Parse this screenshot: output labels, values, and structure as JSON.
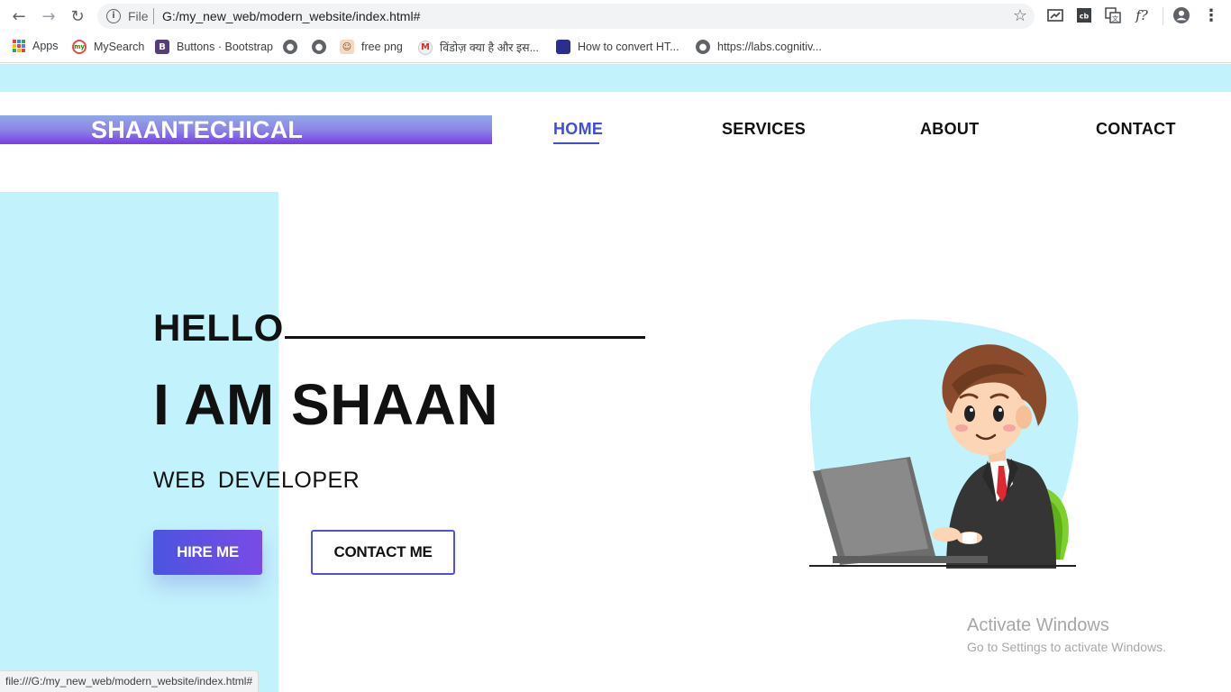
{
  "browser": {
    "file_label": "File",
    "url": "G:/my_new_web/modern_website/index.html#",
    "status_url": "file:///G:/my_new_web/modern_website/index.html#",
    "extension_fx_label": "f?"
  },
  "bookmarks": [
    {
      "label": "Apps"
    },
    {
      "label": "MySearch"
    },
    {
      "label": "Buttons · Bootstrap"
    },
    {
      "label": ""
    },
    {
      "label": ""
    },
    {
      "label": "free png"
    },
    {
      "label": "विंडोज़ क्या है और इस..."
    },
    {
      "label": "How to convert HT..."
    },
    {
      "label": "https://labs.cognitiv..."
    }
  ],
  "site": {
    "brand": "SHAANTECHICAL",
    "nav": [
      "HOME",
      "SERVICES",
      "ABOUT",
      "CONTACT"
    ],
    "hero": {
      "hello": "HELLO",
      "headline": "I AM SHAAN",
      "role": "WEB DEVELOPER",
      "hire_button": "HIRE ME",
      "contact_button": "CONTACT ME"
    }
  },
  "watermark": {
    "line1": "Activate Windows",
    "line2": "Go to Settings to activate Windows."
  },
  "colors": {
    "accent": "#3e4fd6",
    "light_cyan": "#c2f2fb",
    "purple": "#7a3de8"
  }
}
